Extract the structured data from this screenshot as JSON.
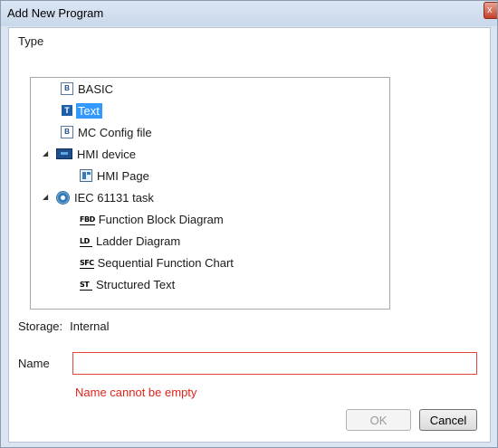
{
  "window": {
    "title": "Add New Program",
    "close_glyph": "x"
  },
  "type_label": "Type",
  "tree": {
    "items": [
      {
        "label": "BASIC",
        "icon": "basic-doc-icon",
        "glyph": "B"
      },
      {
        "label": "Text",
        "icon": "text-doc-icon",
        "glyph": "T",
        "selected": true
      },
      {
        "label": "MC Config file",
        "icon": "mc-config-doc-icon",
        "glyph": "B"
      },
      {
        "label": "HMI device",
        "icon": "hmi-device-icon",
        "expanded": true
      },
      {
        "label": "HMI Page",
        "icon": "hmi-page-icon"
      },
      {
        "label": "IEC 61131 task",
        "icon": "iec-task-icon",
        "expanded": true
      },
      {
        "label": "Function Block Diagram",
        "icon": "fbd-icon",
        "glyph": "FBD"
      },
      {
        "label": "Ladder Diagram",
        "icon": "ld-icon",
        "glyph": "LD"
      },
      {
        "label": "Sequential Function Chart",
        "icon": "sfc-icon",
        "glyph": "SFC"
      },
      {
        "label": "Structured Text",
        "icon": "st-icon",
        "glyph": "ST"
      }
    ]
  },
  "storage": {
    "label": "Storage:",
    "value": "Internal"
  },
  "name": {
    "label": "Name",
    "value": "",
    "error": "Name cannot be empty"
  },
  "buttons": {
    "ok": "OK",
    "cancel": "Cancel"
  },
  "colors": {
    "selection": "#3399ff",
    "error": "#e0241b",
    "error_border": "#e0463e"
  }
}
